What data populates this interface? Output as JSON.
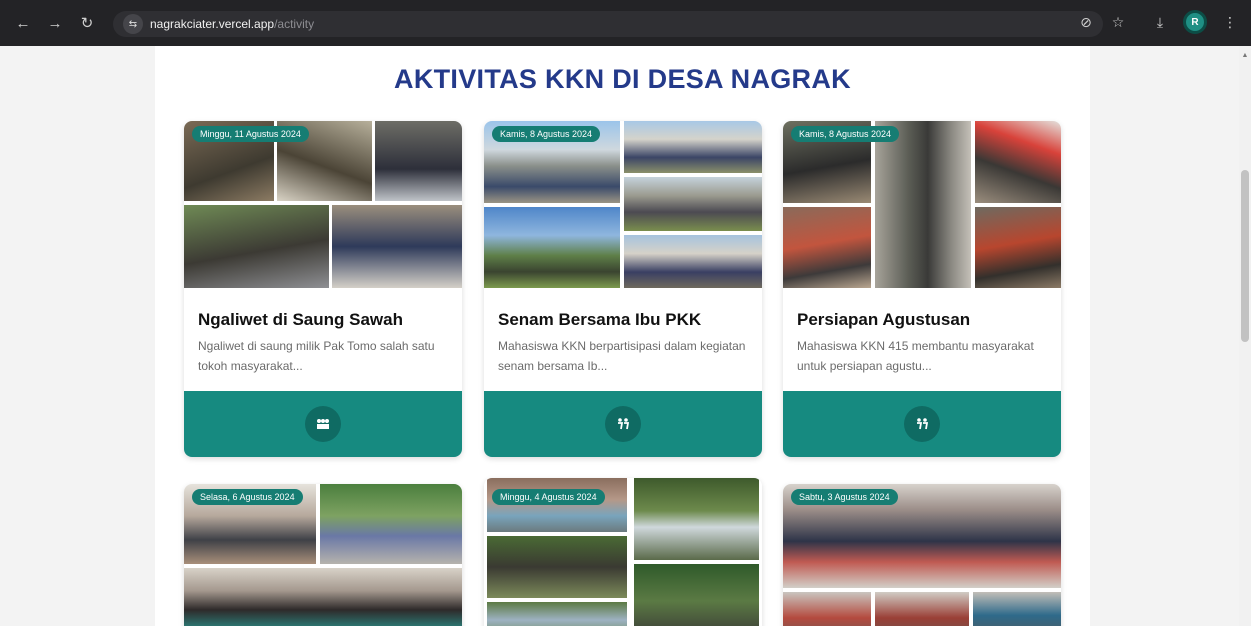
{
  "browser": {
    "back_icon": "←",
    "forward_icon": "→",
    "reload_icon": "↻",
    "site_icon": "⇆",
    "url_host": "nagrakciater.vercel.app",
    "url_path": "/activity",
    "eye_off_icon": "⊘",
    "star_icon": "☆",
    "download_icon": "⤓",
    "avatar_letter": "R",
    "menu_icon": "⋮"
  },
  "page": {
    "title": "AKTIVITAS KKN DI DESA NAGRAK"
  },
  "cards": [
    {
      "date": "Minggu, 11 Agustus 2024",
      "title": "Ngaliwet di Saung Sawah",
      "desc": "Ngaliwet di saung milik Pak Tomo salah satu tokoh masyarakat...",
      "button_icon": "⚑"
    },
    {
      "date": "Kamis, 8 Agustus 2024",
      "title": "Senam Bersama Ibu PKK",
      "desc": "Mahasiswa KKN berpartisipasi dalam kegiatan senam bersama Ib...",
      "button_icon": "⚑"
    },
    {
      "date": "Kamis, 8 Agustus 2024",
      "title": "Persiapan Agustusan",
      "desc": "Mahasiswa KKN 415 membantu masyarakat untuk persiapan agustu...",
      "button_icon": "⚑"
    },
    {
      "date": "Selasa, 6 Agustus 2024"
    },
    {
      "date": "Minggu, 4 Agustus 2024"
    },
    {
      "date": "Sabtu, 3 Agustus 2024"
    }
  ],
  "colors": {
    "title": "#243a8a",
    "accent": "#168a80",
    "accent_dark": "#0f6b63"
  }
}
